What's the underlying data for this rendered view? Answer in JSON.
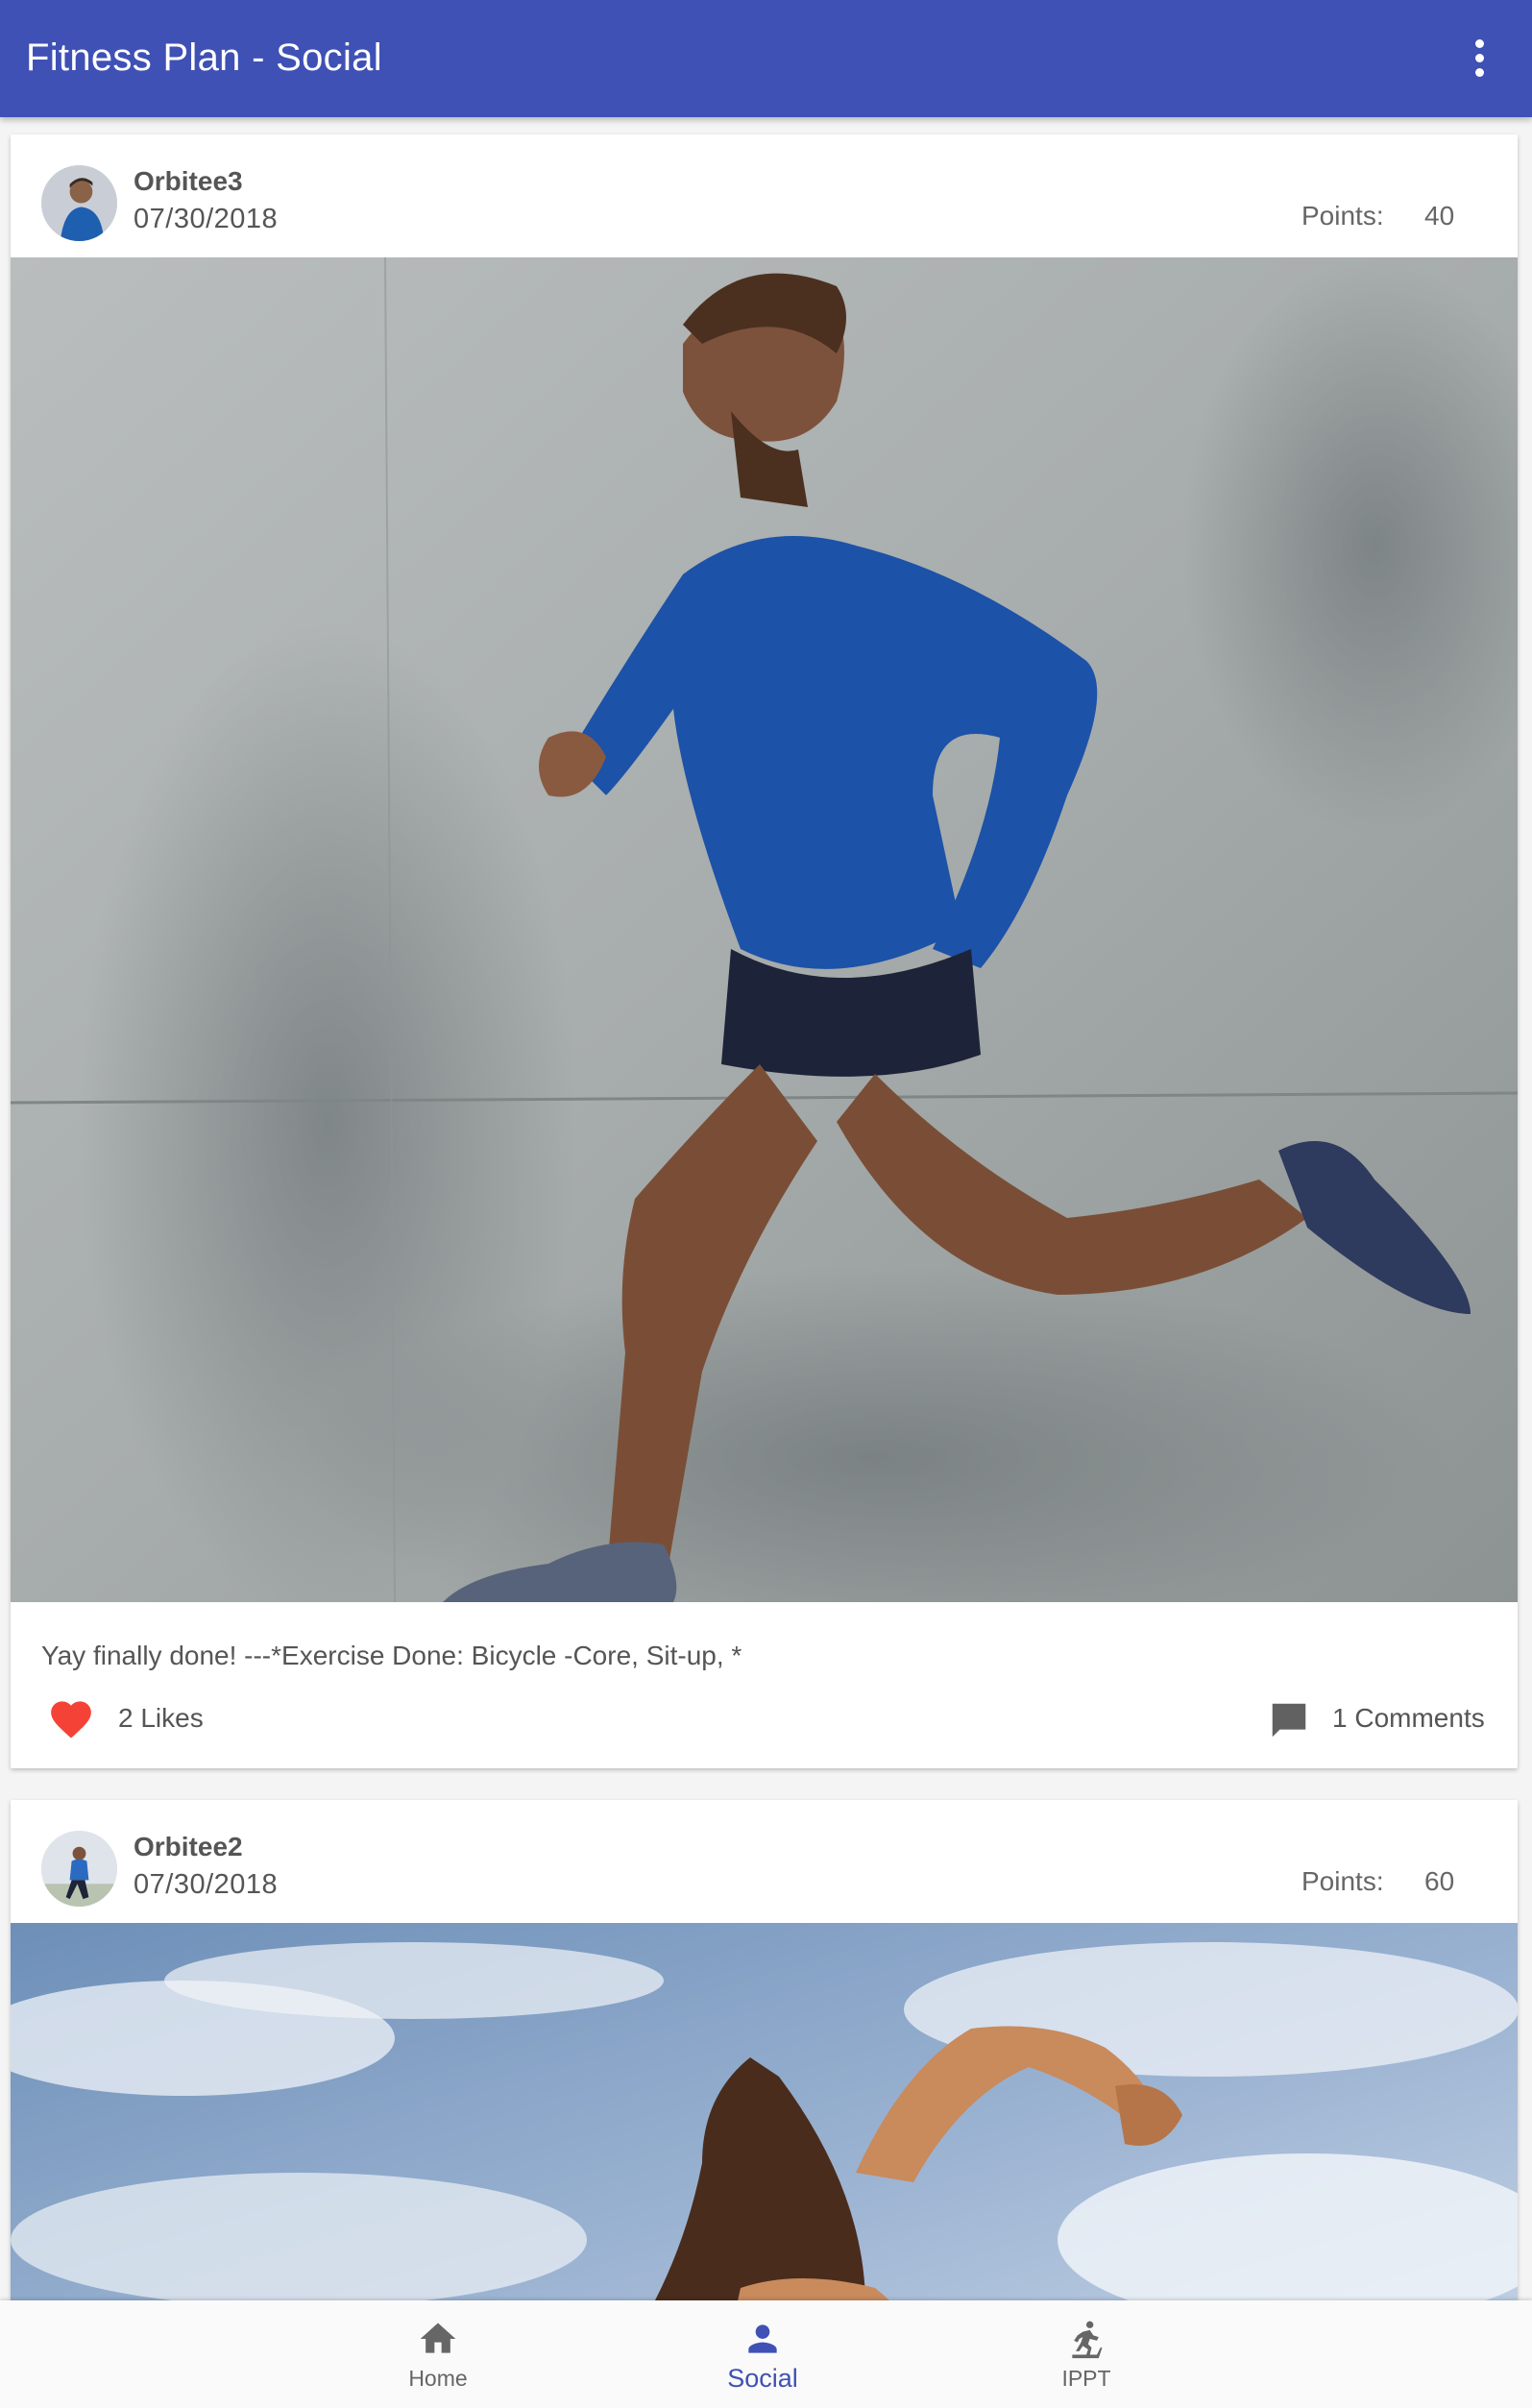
{
  "appbar": {
    "title": "Fitness Plan - Social",
    "menu_icon": "more-vert-icon",
    "background_color": "#3f51b5"
  },
  "posts": [
    {
      "username": "Orbitee3",
      "date": "07/30/2018",
      "points_label": "Points:",
      "points": "40",
      "caption": "Yay finally done!  ---*Exercise Done: Bicycle -Core, Sit-up, *",
      "likes": "2 Likes",
      "comments": "1 Comments",
      "like_icon": "heart-icon",
      "comment_icon": "comment-icon"
    },
    {
      "username": "Orbitee2",
      "date": "07/30/2018",
      "points_label": "Points:",
      "points": "60"
    }
  ],
  "bottom_nav": {
    "items": [
      {
        "label": "Home",
        "icon": "home-icon"
      },
      {
        "label": "Social",
        "icon": "person-icon",
        "active": true
      },
      {
        "label": "IPPT",
        "icon": "treadmill-icon"
      }
    ],
    "active_color": "#3f51b5"
  },
  "colors": {
    "like_red": "#f44336",
    "text_gray": "#555555"
  }
}
